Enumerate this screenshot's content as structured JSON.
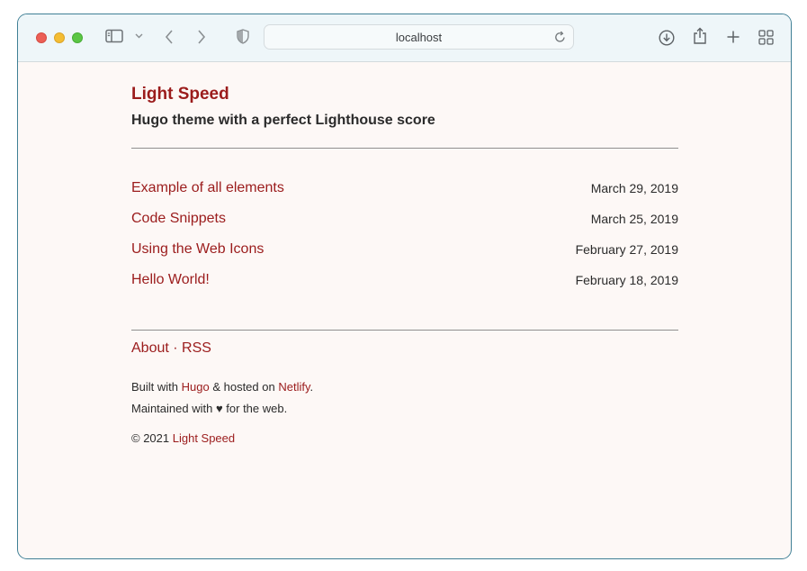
{
  "browser": {
    "address": "localhost"
  },
  "site": {
    "title": "Light Speed",
    "subtitle": "Hugo theme with a perfect Lighthouse score"
  },
  "posts": [
    {
      "title": "Example of all elements",
      "date": "March 29, 2019"
    },
    {
      "title": "Code Snippets",
      "date": "March 25, 2019"
    },
    {
      "title": "Using the Web Icons",
      "date": "February 27, 2019"
    },
    {
      "title": "Hello World!",
      "date": "February 18, 2019"
    }
  ],
  "footer": {
    "links": {
      "about": "About",
      "separator": "·",
      "rss": "RSS"
    },
    "built_prefix": "Built with ",
    "hugo": "Hugo",
    "hosted_text": " & hosted on ",
    "netlify": "Netlify",
    "period": ".",
    "maintained_prefix": "Maintained with ",
    "heart": "♥",
    "maintained_suffix": " for the web.",
    "copyright": "© 2021 ",
    "copyright_link": "Light Speed"
  },
  "colors": {
    "accent": "#9b1c1c",
    "text": "#2b2b2b",
    "page_bg": "#fdf8f6",
    "toolbar_bg": "#eef6f9"
  },
  "icons": [
    "close-light",
    "minimize-light",
    "zoom-light",
    "sidebar-icon",
    "chevron-down-icon",
    "back-icon",
    "forward-icon",
    "shield-icon",
    "reload-icon",
    "download-icon",
    "share-icon",
    "new-tab-icon",
    "tab-overview-icon"
  ]
}
